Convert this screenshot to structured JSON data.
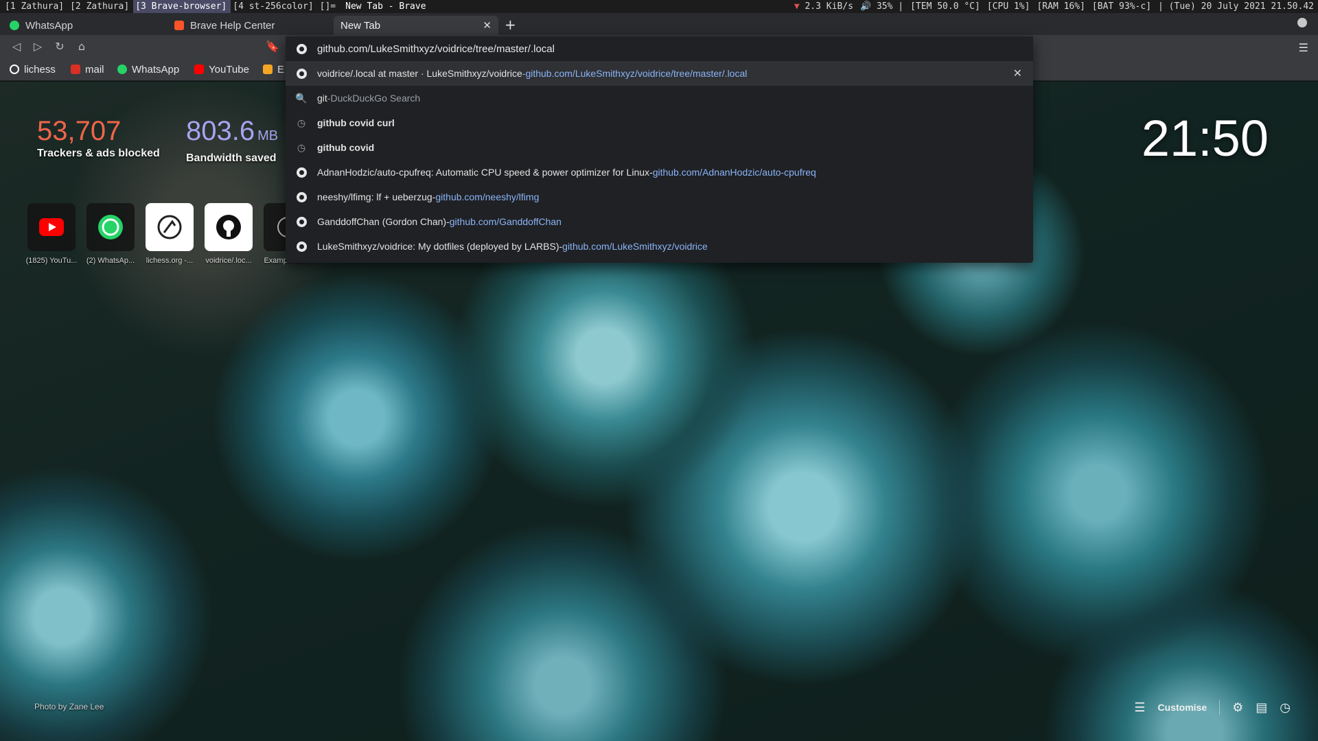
{
  "wm": {
    "tags": [
      "[1 Zathura]",
      "[2 Zathura]",
      "[3 Brave-browser]",
      "[4 st-256color]",
      "[]="
    ],
    "active_tag": 2,
    "window_title": "New Tab - Brave",
    "status": {
      "net": "2.3 KiB/s",
      "volume": "35%",
      "temp": "[TEM 50.0 °C]",
      "cpu": "[CPU 1%]",
      "ram": "[RAM 16%]",
      "bat": "[BAT 93%-c]",
      "datetime": "(Tue) 20 July 2021 21.50.42"
    }
  },
  "tabs": [
    {
      "label": "WhatsApp",
      "icon": "whatsapp-icon"
    },
    {
      "label": "Brave Help Center",
      "icon": "brave-icon"
    },
    {
      "label": "New Tab",
      "icon": "none",
      "close": "✕"
    }
  ],
  "new_tab_symbol": "+",
  "bookmarks": [
    {
      "label": "lichess",
      "color": "#ffffff"
    },
    {
      "label": "mail",
      "color": "#d93025"
    },
    {
      "label": "WhatsApp",
      "color": "#25d366"
    },
    {
      "label": "YouTube",
      "color": "#ff0000"
    },
    {
      "label": "E",
      "color": "#f5a623"
    }
  ],
  "omnibox": {
    "input_value": "github.com/LukeSmithxyz/voidrice/tree/master/.local",
    "suggestions": [
      {
        "icon": "github-icon",
        "title": "voidrice/.local at master · LukeSmithxyz/voidrice",
        "sep": " - ",
        "url": "github.com/LukeSmithxyz/voidrice/tree/master/.local",
        "selected": true
      },
      {
        "icon": "search-icon",
        "title": "git",
        "sep": " - ",
        "url": "",
        "hint": "DuckDuckGo Search"
      },
      {
        "icon": "history-icon",
        "title": "github covid curl",
        "sep": "",
        "url": ""
      },
      {
        "icon": "history-icon",
        "title": "github covid",
        "sep": "",
        "url": ""
      },
      {
        "icon": "github-icon",
        "title": "AdnanHodzic/auto-cpufreq: Automatic CPU speed & power optimizer for Linux",
        "sep": " - ",
        "url": "github.com/AdnanHodzic/auto-cpufreq"
      },
      {
        "icon": "github-icon",
        "title": "neeshy/lfimg: lf + ueberzug",
        "sep": " - ",
        "url": "github.com/neeshy/lfimg"
      },
      {
        "icon": "github-icon",
        "title": "GanddoffChan (Gordon Chan)",
        "sep": " - ",
        "url": "github.com/GanddoffChan"
      },
      {
        "icon": "github-icon",
        "title": "LukeSmithxyz/voidrice: My dotfiles (deployed by LARBS)",
        "sep": " - ",
        "url": "github.com/LukeSmithxyz/voidrice"
      }
    ],
    "close_symbol": "✕"
  },
  "ntp": {
    "trackers": {
      "value": "53,707",
      "label": "Trackers & ads blocked",
      "color": "#f0654a"
    },
    "bandwidth": {
      "value": "803.6",
      "unit": "MB",
      "label": "Bandwidth saved",
      "color": "#a8a3f0"
    },
    "clock": "21:50",
    "tiles": [
      {
        "label": "(1825) YouTu...",
        "icon": "youtube-icon"
      },
      {
        "label": "(2) WhatsAp...",
        "icon": "whatsapp-icon"
      },
      {
        "label": "lichess.org -...",
        "icon": "lichess-icon"
      },
      {
        "label": "voidrice/.loc...",
        "icon": "github-icon"
      },
      {
        "label": "Example Do...",
        "icon": "globe-icon"
      }
    ],
    "photo_credit": "Photo by Zane Lee",
    "customise_label": "Customise"
  }
}
